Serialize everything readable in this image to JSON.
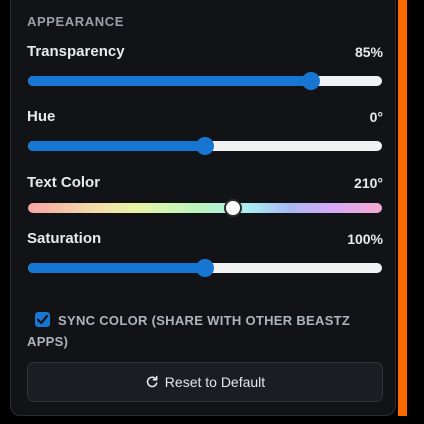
{
  "section": {
    "title": "APPEARANCE"
  },
  "transparency": {
    "label": "Transparency",
    "value": "85%",
    "level": 0.8
  },
  "hue": {
    "label": "Hue",
    "value": "0°",
    "level": 0.5
  },
  "text_color": {
    "label": "Text Color",
    "value": "210°",
    "level": 0.58
  },
  "saturation": {
    "label": "Saturation",
    "value": "100%",
    "level": 0.5
  },
  "sync": {
    "checked": true,
    "label_line1": "SYNC COLOR (SHARE WITH OTHER BEASTZ",
    "label_line2": "APPS)"
  },
  "reset": {
    "label": "Reset to Default",
    "icon": "refresh-icon"
  },
  "colors": {
    "accent": "#1876d3",
    "edge": "#ff6a00",
    "panel": "#121316"
  }
}
